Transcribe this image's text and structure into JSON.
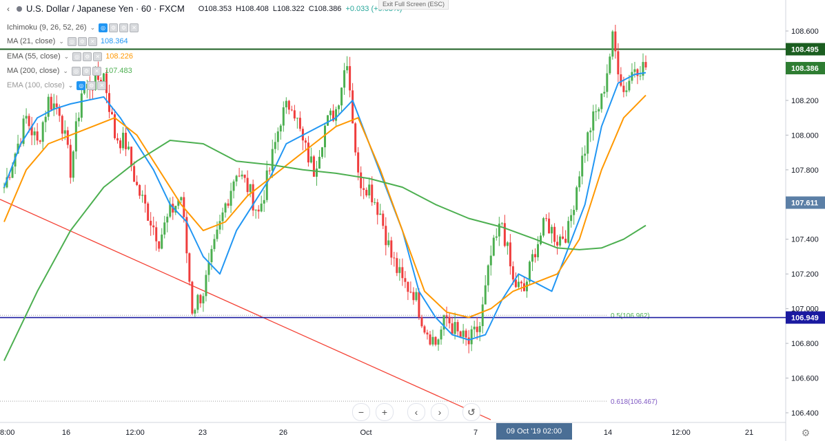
{
  "header": {
    "symbol": "U.S. Dollar / Japanese Yen · 60 · FXCM",
    "open": "O108.353",
    "high": "H108.408",
    "low": "L108.322",
    "close": "C108.386",
    "change": "+0.033 (+0.03%)",
    "exit_fullscreen": "Exit Full Screen (ESC)"
  },
  "studies": [
    {
      "label": "Ichimoku (9, 26, 52, 26)",
      "value": "",
      "color": "#787b86"
    },
    {
      "label": "MA (21, close)",
      "value": "108.364",
      "color": "#2196f3"
    },
    {
      "label": "EMA (55, close)",
      "value": "108.226",
      "color": "#ff9800"
    },
    {
      "label": "MA (200, close)",
      "value": "107.483",
      "color": "#4caf50"
    },
    {
      "label": "EMA (100, close)",
      "value": "",
      "color": "#787b86"
    }
  ],
  "price_labels": [
    {
      "text": "108.495",
      "value": 108.495,
      "color": "#1b5e20"
    },
    {
      "text": "108.386",
      "value": 108.386,
      "color": "#2e7d32"
    },
    {
      "text": "107.611",
      "value": 107.611,
      "color": "#5b7fa6"
    },
    {
      "text": "106.949",
      "value": 106.949,
      "color": "#1a1aa0"
    }
  ],
  "fib_labels": [
    {
      "text": "0.5(106.962)",
      "value": 106.962
    },
    {
      "text": "0.618(106.467)",
      "value": 106.467
    }
  ],
  "time_marker": "09 Oct '19 02:00",
  "nav_buttons": [
    "−",
    "+",
    "‹",
    "›",
    "↺"
  ],
  "colors": {
    "up": "#4caf50",
    "down": "#ef3d3d",
    "ma21": "#2196f3",
    "ema55": "#ff9800",
    "ma200": "#4caf50",
    "trendline": "#f44336",
    "resistance": "#1b5e20",
    "support": "#1a1aa0"
  },
  "chart_data": {
    "type": "line",
    "title": "U.S. Dollar / Japanese Yen · 60 · FXCM",
    "y_axis": {
      "range": [
        106.4,
        108.62
      ],
      "ticks": [
        "108.600",
        "108.400",
        "108.200",
        "108.000",
        "107.800",
        "107.600",
        "107.400",
        "107.200",
        "107.000",
        "106.800",
        "106.600",
        "106.400"
      ]
    },
    "x_axis": {
      "ticks": [
        "8:00",
        "16",
        "12:00",
        "23",
        "26",
        "Oct",
        "7",
        "14",
        "12:00",
        "21"
      ]
    },
    "horizontal_lines": [
      {
        "value": 108.495,
        "color": "#1b5e20"
      },
      {
        "value": 106.949,
        "color": "#1a1aa0"
      }
    ],
    "series": [
      {
        "name": "USDJPY close",
        "style": "candles",
        "x": [
          0,
          4,
          8,
          12,
          16,
          20,
          24,
          28,
          32,
          36,
          40,
          44,
          48,
          52,
          56,
          60,
          64,
          68,
          72,
          76,
          80,
          84,
          88,
          92,
          96,
          100,
          104,
          108,
          112,
          116,
          120,
          124,
          128,
          132,
          136,
          140,
          144,
          148,
          152,
          156,
          160,
          164,
          168,
          172,
          176,
          180,
          184,
          188,
          192,
          196,
          200,
          204,
          208,
          212,
          216,
          220,
          224,
          228,
          232
        ],
        "values": [
          107.7,
          107.9,
          108.1,
          107.95,
          108.2,
          108.15,
          107.8,
          108.25,
          108.3,
          108.35,
          108.0,
          107.95,
          107.7,
          107.55,
          107.4,
          107.55,
          107.65,
          107.0,
          107.1,
          107.35,
          107.6,
          107.8,
          107.7,
          107.55,
          107.8,
          108.1,
          108.2,
          107.95,
          107.8,
          108.05,
          108.15,
          108.45,
          107.75,
          107.7,
          107.55,
          107.3,
          107.15,
          107.1,
          106.9,
          106.8,
          106.95,
          106.85,
          106.8,
          106.9,
          107.3,
          107.5,
          107.15,
          107.1,
          107.35,
          107.5,
          107.4,
          107.45,
          107.8,
          108.05,
          108.2,
          108.55,
          108.25,
          108.4,
          108.39
        ]
      },
      {
        "name": "MA (21, close)",
        "x": [
          0,
          6,
          12,
          18,
          24,
          30,
          36,
          42,
          48,
          54,
          60,
          66,
          72,
          78,
          84,
          90,
          96,
          102,
          108,
          114,
          120,
          126,
          132,
          138,
          144,
          150,
          156,
          162,
          168,
          174,
          180,
          186,
          192,
          198,
          204,
          210,
          216,
          222,
          228,
          232
        ],
        "values": [
          107.7,
          107.95,
          108.1,
          108.15,
          108.18,
          108.2,
          108.22,
          108.1,
          107.95,
          107.8,
          107.6,
          107.5,
          107.3,
          107.2,
          107.45,
          107.6,
          107.75,
          107.95,
          108.0,
          108.05,
          108.1,
          108.2,
          107.95,
          107.7,
          107.45,
          107.1,
          106.95,
          106.85,
          106.82,
          106.85,
          107.05,
          107.2,
          107.15,
          107.1,
          107.35,
          107.6,
          108.05,
          108.3,
          108.35,
          108.36
        ]
      },
      {
        "name": "EMA (55, close)",
        "x": [
          0,
          8,
          16,
          24,
          32,
          40,
          48,
          56,
          64,
          72,
          80,
          88,
          96,
          104,
          112,
          120,
          128,
          136,
          144,
          152,
          160,
          168,
          176,
          184,
          192,
          200,
          208,
          216,
          224,
          232
        ],
        "values": [
          107.5,
          107.8,
          107.95,
          108.0,
          108.05,
          108.1,
          108.0,
          107.8,
          107.6,
          107.45,
          107.5,
          107.65,
          107.75,
          107.85,
          107.95,
          108.05,
          108.1,
          107.8,
          107.45,
          107.1,
          106.98,
          106.95,
          107.0,
          107.1,
          107.15,
          107.2,
          107.4,
          107.8,
          108.1,
          108.23
        ]
      },
      {
        "name": "MA (200, close)",
        "x": [
          0,
          12,
          24,
          36,
          48,
          60,
          72,
          84,
          96,
          108,
          120,
          132,
          144,
          156,
          168,
          180,
          192,
          200,
          208,
          216,
          224,
          232
        ],
        "values": [
          106.7,
          107.1,
          107.45,
          107.7,
          107.85,
          107.97,
          107.95,
          107.85,
          107.83,
          107.8,
          107.78,
          107.75,
          107.7,
          107.6,
          107.52,
          107.47,
          107.4,
          107.35,
          107.34,
          107.35,
          107.4,
          107.48
        ]
      }
    ]
  }
}
